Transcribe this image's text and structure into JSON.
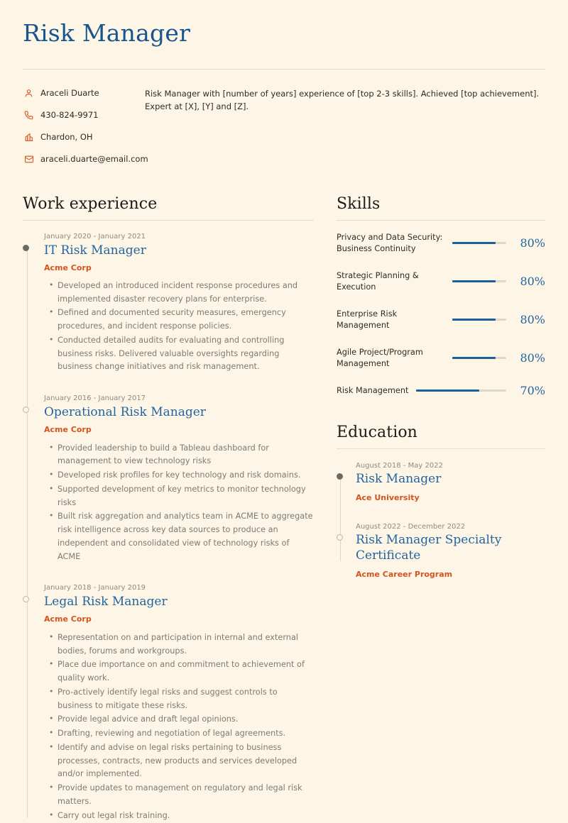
{
  "header": {
    "name_title": "Risk Manager"
  },
  "contact": {
    "items": [
      {
        "icon": "person-icon",
        "value": "Araceli Duarte"
      },
      {
        "icon": "phone-icon",
        "value": "430-824-9971"
      },
      {
        "icon": "city-icon",
        "value": "Chardon, OH"
      },
      {
        "icon": "mail-icon",
        "value": "araceli.duarte@email.com"
      }
    ]
  },
  "summary": {
    "text": "Risk Manager with [number of years] experience of [top 2-3 skills]. Achieved [top achievement]. Expert at [X], [Y] and [Z]."
  },
  "work": {
    "title": "Work experience",
    "entries": [
      {
        "date": "January 2020 - January 2021",
        "job_title": "IT Risk Manager",
        "organization": "Acme Corp",
        "marker": "filled",
        "points": [
          "Developed an introduced incident response procedures and implemented disaster recovery plans for enterprise.",
          "Defined and documented security measures, emergency procedures, and incident response policies.",
          "Conducted detailed audits for evaluating and controlling business risks. Delivered valuable oversights regarding business change initiatives and risk management."
        ]
      },
      {
        "date": "January 2016 - January 2017",
        "job_title": "Operational Risk Manager",
        "organization": "Acme Corp",
        "marker": "hollow",
        "points": [
          "Provided leadership to build a Tableau dashboard for management to view technology risks",
          "Developed risk profiles for key technology and risk domains.",
          "Supported development of key metrics to monitor technology risks",
          "Built risk aggregation and analytics team in ACME to aggregate risk intelligence across key data sources to produce an independent and consolidated view of technology risks of ACME"
        ]
      },
      {
        "date": "January 2018 - January 2019",
        "job_title": "Legal Risk Manager",
        "organization": "Acme Corp",
        "marker": "hollow",
        "points": [
          "Representation on and participation in internal and external bodies, forums and workgroups.",
          "Place due importance on and commitment to achievement of quality work.",
          "Pro-actively identify legal risks and suggest controls to business to mitigate these risks.",
          "Provide legal advice and draft legal opinions.",
          "Drafting, reviewing and negotiation of legal agreements.",
          "Identify and advise on legal risks pertaining to business processes, contracts, new products and services developed and/or implemented.",
          "Provide updates to management on regulatory and legal risk matters.",
          "Carry out legal risk training."
        ]
      }
    ]
  },
  "skills": {
    "title": "Skills",
    "items": [
      {
        "label": "Privacy and Data Security: Business Continuity",
        "percent": "80%",
        "value": 80
      },
      {
        "label": "Strategic Planning & Execution",
        "percent": "80%",
        "value": 80
      },
      {
        "label": "Enterprise Risk Management",
        "percent": "80%",
        "value": 80
      },
      {
        "label": "Agile Project/Program Management",
        "percent": "80%",
        "value": 80
      },
      {
        "label": "Risk Management",
        "percent": "70%",
        "value": 70
      }
    ]
  },
  "education": {
    "title": "Education",
    "entries": [
      {
        "date": "August 2018 - May 2022",
        "degree": "Risk Manager",
        "institution": "Ace University",
        "marker": "filled"
      },
      {
        "date": "August 2022 - December 2022",
        "degree": "Risk Manager Specialty Certificate",
        "institution": "Acme Career Program",
        "marker": "hollow"
      }
    ]
  },
  "colors": {
    "background": "#fdf6e6",
    "heading_blue": "#17558f",
    "title_blue": "#23649f",
    "accent_orange": "#d4531e",
    "muted_gray": "#7e7a73",
    "date_gray": "#908a7f",
    "bar_fill": "#1c5f9e",
    "bar_track": "#ddd8cc",
    "rule": "#e7ddc8"
  }
}
